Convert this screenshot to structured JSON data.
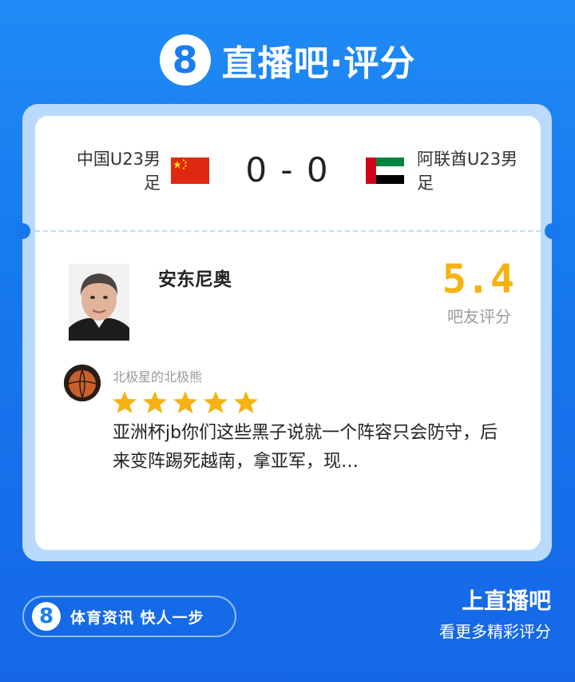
{
  "brand": {
    "badge": "8",
    "title": "直播吧·评分"
  },
  "match": {
    "home_team": "中国U23男足",
    "away_team": "阿联酋U23男足",
    "score": "0 - 0",
    "home_flag": "china-flag",
    "away_flag": "uae-flag"
  },
  "player": {
    "name": "安东尼奥",
    "rating": "5.4",
    "rating_label": "吧友评分"
  },
  "comment": {
    "author": "北极星的北极熊",
    "stars": 5,
    "text": "亚洲杯jb你们这些黑子说就一个阵容只会防守，后来变阵踢死越南，拿亚军，现…"
  },
  "footer": {
    "badge": "8",
    "slogan": "体育资讯 快人一步",
    "cta_title": "上直播吧",
    "cta_subtitle": "看更多精彩评分"
  },
  "colors": {
    "background": "#1677ee",
    "rating": "#f6b213",
    "star": "#f6b213",
    "frame": "#b9dafd"
  }
}
